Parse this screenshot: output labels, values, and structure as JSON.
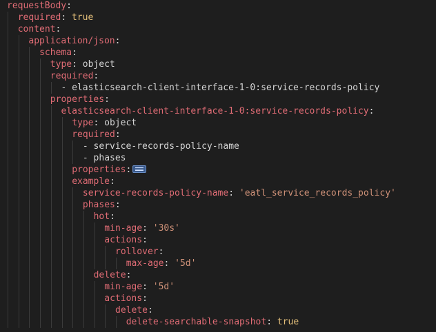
{
  "editor": {
    "lines": [
      {
        "indent": 0,
        "parts": [
          {
            "t": "key",
            "v": "requestBody"
          },
          {
            "t": "punct",
            "v": ":"
          }
        ]
      },
      {
        "indent": 1,
        "parts": [
          {
            "t": "key",
            "v": "required"
          },
          {
            "t": "punct",
            "v": ": "
          },
          {
            "t": "bool",
            "v": "true"
          }
        ]
      },
      {
        "indent": 1,
        "parts": [
          {
            "t": "key",
            "v": "content"
          },
          {
            "t": "punct",
            "v": ":"
          }
        ]
      },
      {
        "indent": 2,
        "parts": [
          {
            "t": "key",
            "v": "application/json"
          },
          {
            "t": "punct",
            "v": ":"
          }
        ]
      },
      {
        "indent": 3,
        "parts": [
          {
            "t": "key",
            "v": "schema"
          },
          {
            "t": "punct",
            "v": ":"
          }
        ]
      },
      {
        "indent": 4,
        "parts": [
          {
            "t": "key",
            "v": "type"
          },
          {
            "t": "punct",
            "v": ": "
          },
          {
            "t": "plain",
            "v": "object"
          }
        ]
      },
      {
        "indent": 4,
        "parts": [
          {
            "t": "key",
            "v": "required"
          },
          {
            "t": "punct",
            "v": ":"
          }
        ]
      },
      {
        "indent": 5,
        "parts": [
          {
            "t": "punct",
            "v": "- "
          },
          {
            "t": "plain",
            "v": "elasticsearch-client-interface-1-0:service-records-policy"
          }
        ]
      },
      {
        "indent": 4,
        "parts": [
          {
            "t": "key",
            "v": "properties"
          },
          {
            "t": "punct",
            "v": ":"
          }
        ]
      },
      {
        "indent": 5,
        "parts": [
          {
            "t": "key",
            "v": "elasticsearch-client-interface-1-0:service-records-policy"
          },
          {
            "t": "punct",
            "v": ":"
          }
        ]
      },
      {
        "indent": 6,
        "parts": [
          {
            "t": "key",
            "v": "type"
          },
          {
            "t": "punct",
            "v": ": "
          },
          {
            "t": "plain",
            "v": "object"
          }
        ]
      },
      {
        "indent": 6,
        "parts": [
          {
            "t": "key",
            "v": "required"
          },
          {
            "t": "punct",
            "v": ":"
          }
        ]
      },
      {
        "indent": 7,
        "parts": [
          {
            "t": "punct",
            "v": "- "
          },
          {
            "t": "plain",
            "v": "service-records-policy-name"
          }
        ]
      },
      {
        "indent": 7,
        "parts": [
          {
            "t": "punct",
            "v": "- "
          },
          {
            "t": "plain",
            "v": "phases"
          }
        ]
      },
      {
        "indent": 6,
        "parts": [
          {
            "t": "key",
            "v": "properties"
          },
          {
            "t": "punct",
            "v": ":"
          }
        ],
        "fold": true
      },
      {
        "indent": 6,
        "parts": [
          {
            "t": "key",
            "v": "example"
          },
          {
            "t": "punct",
            "v": ":"
          }
        ]
      },
      {
        "indent": 7,
        "parts": [
          {
            "t": "key",
            "v": "service-records-policy-name"
          },
          {
            "t": "punct",
            "v": ": "
          },
          {
            "t": "str",
            "v": "'eatl_service_records_policy'"
          }
        ]
      },
      {
        "indent": 7,
        "parts": [
          {
            "t": "key",
            "v": "phases"
          },
          {
            "t": "punct",
            "v": ":"
          }
        ]
      },
      {
        "indent": 8,
        "parts": [
          {
            "t": "key",
            "v": "hot"
          },
          {
            "t": "punct",
            "v": ":"
          }
        ]
      },
      {
        "indent": 9,
        "parts": [
          {
            "t": "key",
            "v": "min-age"
          },
          {
            "t": "punct",
            "v": ": "
          },
          {
            "t": "str",
            "v": "'30s'"
          }
        ]
      },
      {
        "indent": 9,
        "parts": [
          {
            "t": "key",
            "v": "actions"
          },
          {
            "t": "punct",
            "v": ":"
          }
        ]
      },
      {
        "indent": 10,
        "parts": [
          {
            "t": "key",
            "v": "rollover"
          },
          {
            "t": "punct",
            "v": ":"
          }
        ]
      },
      {
        "indent": 11,
        "parts": [
          {
            "t": "key",
            "v": "max-age"
          },
          {
            "t": "punct",
            "v": ": "
          },
          {
            "t": "str",
            "v": "'5d'"
          }
        ]
      },
      {
        "indent": 8,
        "parts": [
          {
            "t": "key",
            "v": "delete"
          },
          {
            "t": "punct",
            "v": ":"
          }
        ]
      },
      {
        "indent": 9,
        "parts": [
          {
            "t": "key",
            "v": "min-age"
          },
          {
            "t": "punct",
            "v": ": "
          },
          {
            "t": "str",
            "v": "'5d'"
          }
        ]
      },
      {
        "indent": 9,
        "parts": [
          {
            "t": "key",
            "v": "actions"
          },
          {
            "t": "punct",
            "v": ":"
          }
        ]
      },
      {
        "indent": 10,
        "parts": [
          {
            "t": "key",
            "v": "delete"
          },
          {
            "t": "punct",
            "v": ":"
          }
        ]
      },
      {
        "indent": 11,
        "parts": [
          {
            "t": "key",
            "v": "delete-searchable-snapshot"
          },
          {
            "t": "punct",
            "v": ": "
          },
          {
            "t": "bool",
            "v": "true"
          }
        ]
      }
    ],
    "fold_icon": "ellipsis-fold-icon"
  }
}
